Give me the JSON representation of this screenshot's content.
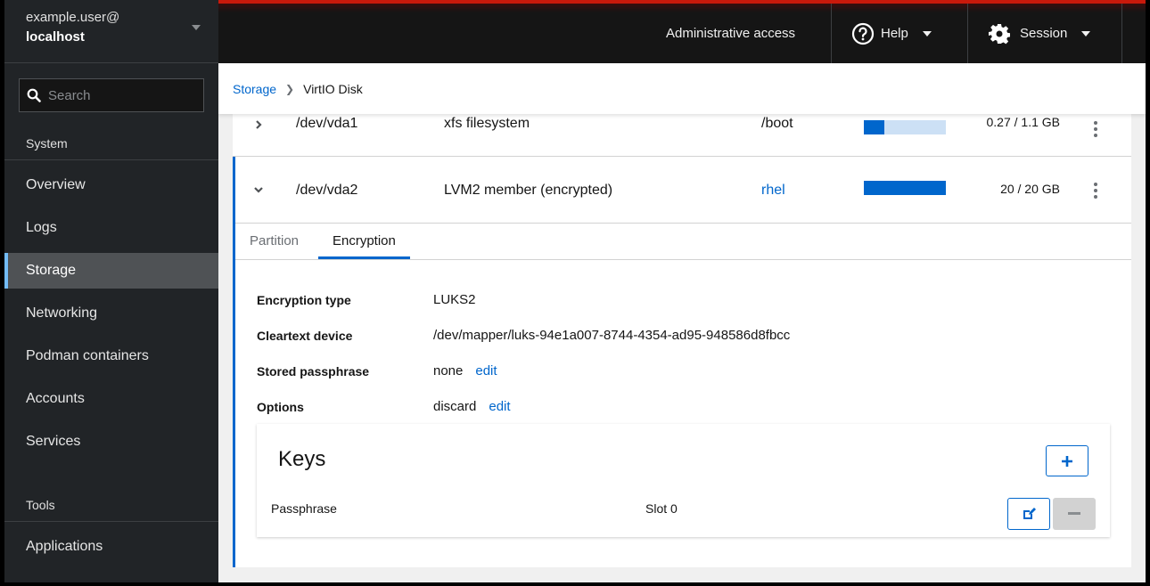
{
  "host": {
    "user": "example.user@",
    "name": "localhost"
  },
  "search": {
    "placeholder": "Search"
  },
  "sidebar": {
    "section_system": "System",
    "items": [
      {
        "label": "Overview"
      },
      {
        "label": "Logs"
      },
      {
        "label": "Storage",
        "active": true
      },
      {
        "label": "Networking"
      },
      {
        "label": "Podman containers"
      },
      {
        "label": "Accounts"
      },
      {
        "label": "Services"
      }
    ],
    "section_tools": "Tools",
    "tools_items": [
      {
        "label": "Applications"
      }
    ]
  },
  "topbar": {
    "admin_access": "Administrative access",
    "help": "Help",
    "session": "Session",
    "accent_color": "#c9190b"
  },
  "breadcrumb": {
    "parent": "Storage",
    "current": "VirtIO Disk"
  },
  "partitions": [
    {
      "device": "/dev/vda1",
      "content": "xfs filesystem",
      "mount": "/boot",
      "mount_is_link": false,
      "usage_fraction": 0.245,
      "size": "0.27 / 1.1 GB",
      "expanded": false
    },
    {
      "device": "/dev/vda2",
      "content": "LVM2 member (encrypted)",
      "mount": "rhel",
      "mount_is_link": true,
      "usage_fraction": 1.0,
      "size": "20 / 20 GB",
      "expanded": true
    }
  ],
  "tabs": [
    {
      "label": "Partition"
    },
    {
      "label": "Encryption",
      "active": true
    }
  ],
  "encryption": {
    "type_label": "Encryption type",
    "type_value": "LUKS2",
    "cleartext_label": "Cleartext device",
    "cleartext_value": "/dev/mapper/luks-94e1a007-8744-4354-ad95-948586d8fbcc",
    "passphrase_label": "Stored passphrase",
    "passphrase_value": "none",
    "passphrase_edit": "edit",
    "options_label": "Options",
    "options_value": "discard",
    "options_edit": "edit"
  },
  "keys": {
    "title": "Keys",
    "rows": [
      {
        "type": "Passphrase",
        "slot": "Slot 0"
      }
    ]
  },
  "colors": {
    "primary": "#0066cc",
    "usage_bg": "#cce0f5",
    "sidebar_active_border": "#73bcf7"
  }
}
